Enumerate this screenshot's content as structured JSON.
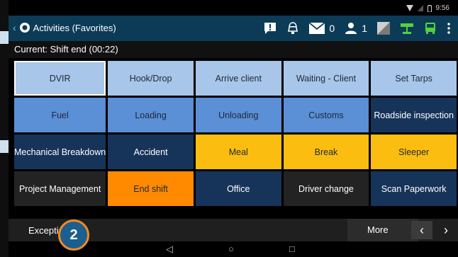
{
  "status_bar": {
    "time": "9:56"
  },
  "app_bar": {
    "back_glyph": "‹",
    "title": "Activities (Favorites)",
    "messages_count": "0",
    "users_count": "1"
  },
  "current": {
    "text": "Current:  Shift end (00:22)"
  },
  "tiles": [
    {
      "label": "DVIR",
      "bg": "#a8c6ea",
      "color": "#1e2936"
    },
    {
      "label": "Hook/Drop",
      "bg": "#a8c6ea",
      "color": "#1e2936"
    },
    {
      "label": "Arrive client",
      "bg": "#a8c6ea",
      "color": "#1e2936"
    },
    {
      "label": "Waiting - Client",
      "bg": "#a8c6ea",
      "color": "#1e2936"
    },
    {
      "label": "Set Tarps",
      "bg": "#a8c6ea",
      "color": "#1e2936"
    },
    {
      "label": "Fuel",
      "bg": "#5b8fd6",
      "color": "#1e2936"
    },
    {
      "label": "Loading",
      "bg": "#5b8fd6",
      "color": "#1e2936"
    },
    {
      "label": "Unloading",
      "bg": "#5b8fd6",
      "color": "#1e2936"
    },
    {
      "label": "Customs",
      "bg": "#5b8fd6",
      "color": "#1e2936"
    },
    {
      "label": "Roadside inspection",
      "bg": "#16345a",
      "color": "#ffffff"
    },
    {
      "label": "Mechanical Breakdown",
      "bg": "#16345a",
      "color": "#ffffff"
    },
    {
      "label": "Accident",
      "bg": "#16345a",
      "color": "#ffffff"
    },
    {
      "label": "Meal",
      "bg": "#fbbd10",
      "color": "#1e2936"
    },
    {
      "label": "Break",
      "bg": "#fbbd10",
      "color": "#1e2936"
    },
    {
      "label": "Sleeper",
      "bg": "#fbbd10",
      "color": "#1e2936"
    },
    {
      "label": "Project Management",
      "bg": "#232323",
      "color": "#ffffff"
    },
    {
      "label": "End shift",
      "bg": "#ff8a00",
      "color": "#1e2936"
    },
    {
      "label": "Office",
      "bg": "#16345a",
      "color": "#ffffff"
    },
    {
      "label": "Driver change",
      "bg": "#232323",
      "color": "#ffffff"
    },
    {
      "label": "Scan Paperwork",
      "bg": "#16345a",
      "color": "#ffffff"
    }
  ],
  "bottom_bar": {
    "exceptions_label": "Exceptio",
    "more_label": "More",
    "prev_glyph": "‹",
    "next_glyph": "›"
  },
  "callout": {
    "number": "2"
  },
  "nav_bar": {
    "back": "◁",
    "home": "○",
    "recents": "□"
  },
  "colors": {
    "app_bar": "#0b3b57",
    "callout_fill": "#1b5f8e",
    "callout_ring": "#f58a1f",
    "truck_green": "#52d23c"
  }
}
